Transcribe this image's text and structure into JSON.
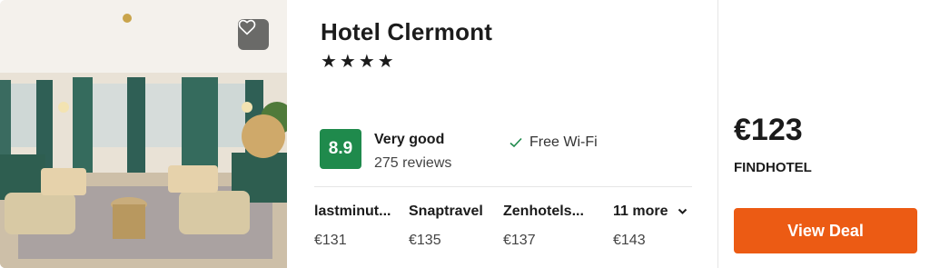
{
  "hotel": {
    "name": "Hotel Clermont",
    "stars": "★★★★",
    "score": "8.9",
    "rating_label": "Very good",
    "reviews": "275 reviews",
    "amenity": "Free Wi-Fi"
  },
  "providers": [
    {
      "name": "lastminut...",
      "price": "€131"
    },
    {
      "name": "Snaptravel",
      "price": "€135"
    },
    {
      "name": "Zenhotels...",
      "price": "€137"
    },
    {
      "name": "11 more",
      "price": "€143"
    }
  ],
  "deal": {
    "price": "€123",
    "provider": "FINDHOTEL",
    "button_label": "View Deal"
  },
  "colors": {
    "score_badge": "#1f8a4c",
    "deal_button": "#ec5b14",
    "check": "#1f8a4c"
  },
  "icons": {
    "favorite": "heart-icon",
    "amenity": "checkmark-icon",
    "more": "chevron-down-icon"
  }
}
